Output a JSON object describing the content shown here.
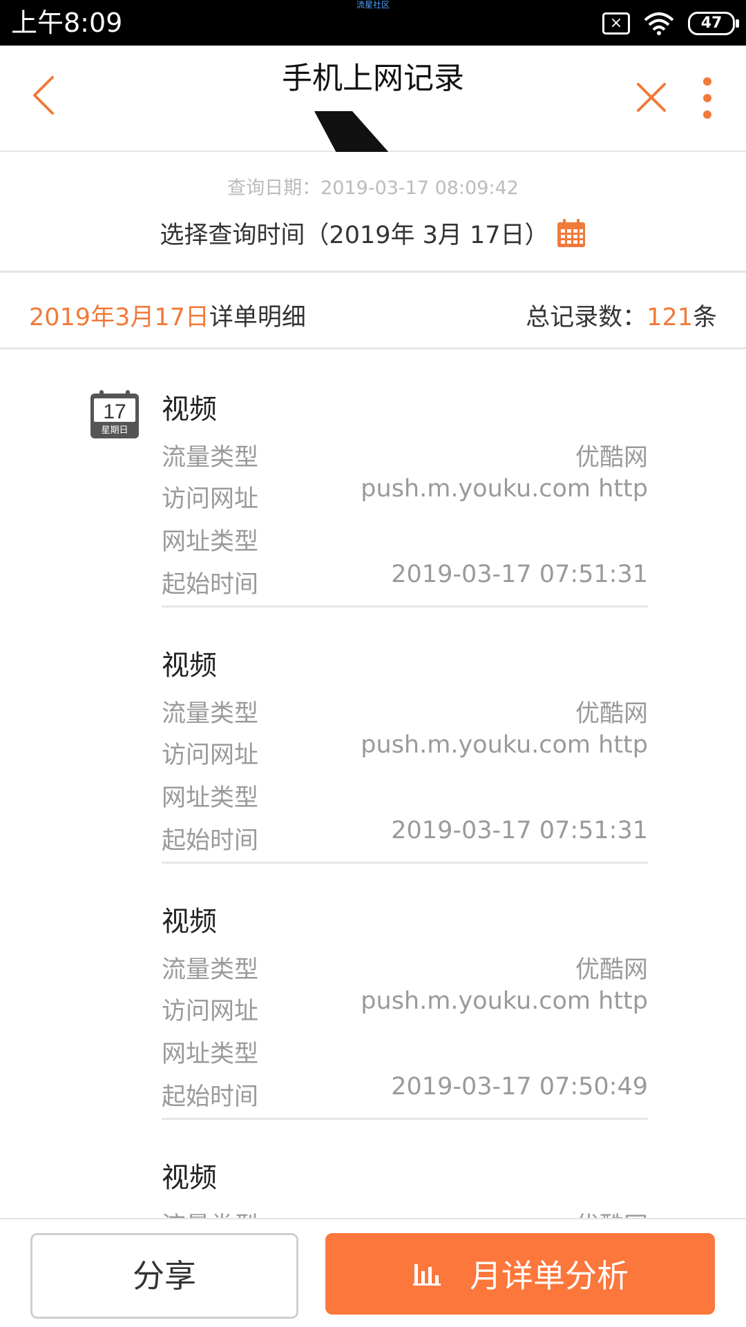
{
  "status_bar": {
    "time": "上午8:09",
    "center_label": "流星社区",
    "battery": "47"
  },
  "header": {
    "title": "手机上网记录"
  },
  "query": {
    "query_date": "查询日期：2019-03-17 08:09:42",
    "choose_time": "选择查询时间（2019年 3月 17日）"
  },
  "summary": {
    "date_label": "2019年3月17日",
    "detail_suffix": "详单明细",
    "total_label": "总记录数：",
    "total_count": "121",
    "count_unit": "条"
  },
  "day_badge": {
    "day": "17",
    "weekday": "星期日"
  },
  "records": [
    {
      "title": "视频",
      "flow_type_label": "流量类型",
      "flow_type": "优酷网",
      "url_label": "访问网址",
      "url": "push.m.youku.com http",
      "url_type_label": "网址类型",
      "url_type": "",
      "start_label": "起始时间",
      "start_time": "2019-03-17 07:51:31"
    },
    {
      "title": "视频",
      "flow_type_label": "流量类型",
      "flow_type": "优酷网",
      "url_label": "访问网址",
      "url": "push.m.youku.com http",
      "url_type_label": "网址类型",
      "url_type": "",
      "start_label": "起始时间",
      "start_time": "2019-03-17 07:51:31"
    },
    {
      "title": "视频",
      "flow_type_label": "流量类型",
      "flow_type": "优酷网",
      "url_label": "访问网址",
      "url": "push.m.youku.com http",
      "url_type_label": "网址类型",
      "url_type": "",
      "start_label": "起始时间",
      "start_time": "2019-03-17 07:50:49"
    },
    {
      "title": "视频",
      "flow_type_label": "流量类型",
      "flow_type": "优酷网"
    }
  ],
  "buttons": {
    "share": "分享",
    "analysis": "月详单分析"
  },
  "colors": {
    "accent": "#f07a3a",
    "button_orange": "#fc773c"
  }
}
